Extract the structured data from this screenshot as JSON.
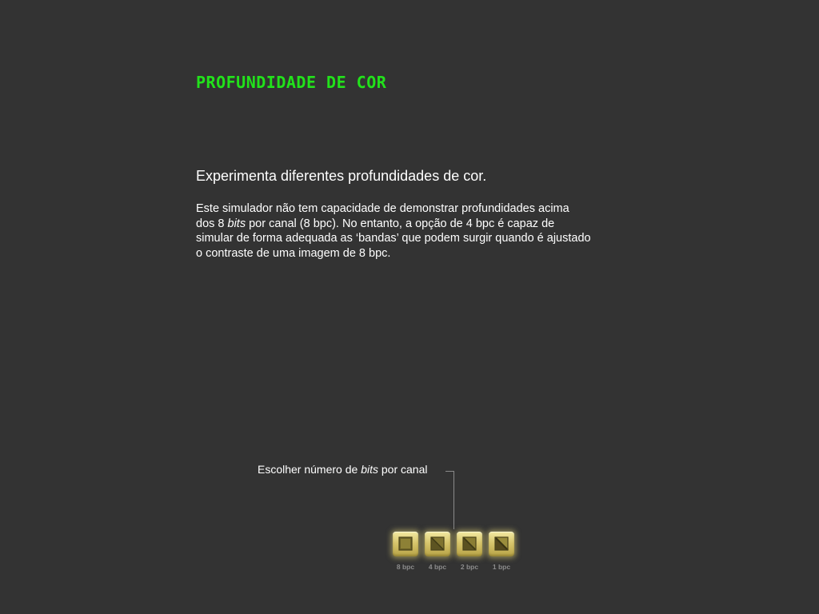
{
  "header": {
    "title": "PROFUNDIDADE DE COR"
  },
  "intro": {
    "subtitle": "Experimenta diferentes profundidades de cor.",
    "lines": [
      {
        "before": "Este simulador não tem capacidade de demonstrar profundidades acima",
        "em": "",
        "after": ""
      },
      {
        "before": "dos 8 ",
        "em": "bits",
        "after": " por canal (8 bpc). No entanto, a opção de 4 bpc é capaz de"
      },
      {
        "before": "simular de forma adequada as ‘bandas’ que podem surgir quando é ajustado",
        "em": "",
        "after": ""
      },
      {
        "before": "o contraste de uma imagem de 8 bpc.",
        "em": "",
        "after": ""
      }
    ]
  },
  "selector": {
    "label_before": "Escolher número de ",
    "label_em": "bits",
    "label_after": " por canal",
    "options": [
      {
        "label": "8 bpc",
        "icon": "square-icon"
      },
      {
        "label": "4 bpc",
        "icon": "diagonal-square-icon"
      },
      {
        "label": "2 bpc",
        "icon": "diagonal-square-icon"
      },
      {
        "label": "1 bpc",
        "icon": "diagonal-square-icon"
      }
    ]
  },
  "colors": {
    "background": "#333333",
    "title": "#22e21b",
    "button_face": "#d8c66d",
    "button_glow": "#e6d778",
    "caption": "#8c8c8c"
  }
}
